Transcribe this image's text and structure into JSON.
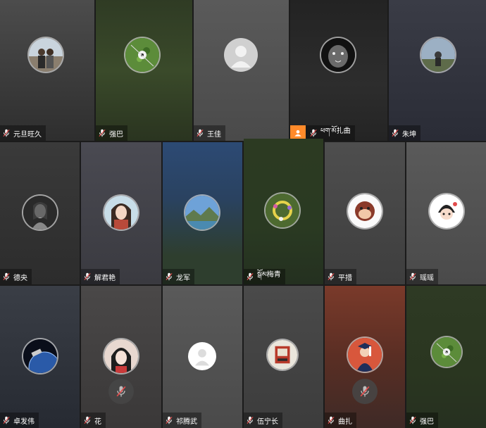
{
  "participants": [
    {
      "name": "元旦旺久",
      "avatar": "couple-photo-avatar-icon"
    },
    {
      "name": "强巴",
      "avatar": "grass-ball-avatar-icon"
    },
    {
      "name": "王佳",
      "avatar": "default-person-avatar-icon"
    },
    {
      "name": "ཕག་མོ扎曲",
      "avatar": "tiger-avatar-icon",
      "host": true
    },
    {
      "name": "朱坤",
      "avatar": "outdoor-person-avatar-icon"
    },
    {
      "name": "德央",
      "avatar": "woman-bw-avatar-icon"
    },
    {
      "name": "解君艳",
      "avatar": "anime-girl-avatar-icon"
    },
    {
      "name": "龙军",
      "avatar": "landscape-avatar-icon"
    },
    {
      "name": "སྒོམ梅青",
      "avatar": "flower-wreath-avatar-icon"
    },
    {
      "name": "平措",
      "avatar": "monkey-cartoon-avatar-icon"
    },
    {
      "name": "瑶瑶",
      "avatar": "cartoon-girl-avatar-icon"
    },
    {
      "name": "卓发伟",
      "avatar": "earth-space-avatar-icon"
    },
    {
      "name": "花",
      "avatar": "anime-portrait-avatar-icon",
      "muted": true
    },
    {
      "name": "祁腾武",
      "avatar": "default-person-avatar-icon"
    },
    {
      "name": "伍宁长",
      "avatar": "poster-avatar-icon"
    },
    {
      "name": "曲扎",
      "avatar": "graduate-avatar-icon",
      "muted": true
    },
    {
      "name": "强巴",
      "avatar": "grass-ball-avatar-icon"
    }
  ],
  "colors": {
    "host_badge": "#ff8a2a",
    "label_bg": "rgba(0,0,0,0.35)",
    "mic_slash": "#e24b4b"
  }
}
